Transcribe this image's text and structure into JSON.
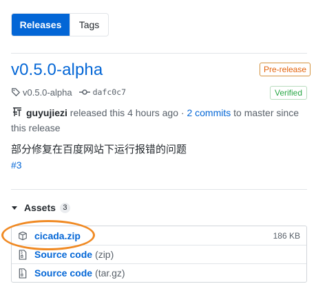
{
  "tabs": [
    {
      "label": "Releases",
      "active": true
    },
    {
      "label": "Tags",
      "active": false
    }
  ],
  "release": {
    "title": "v0.5.0-alpha",
    "prerelease_label": "Pre-release",
    "verified_label": "Verified",
    "tag": "v0.5.0-alpha",
    "commit_sha": "dafc0c7",
    "author": "guyujiezi",
    "released_text": " released this 4 hours ago · ",
    "commits_link": "2 commits",
    "to_master_text": " to master since this release",
    "description": "部分修复在百度网站下运行报错的问题",
    "issue_link": "#3"
  },
  "assets": {
    "label": "Assets",
    "count": "3",
    "items": [
      {
        "name": "cicada.zip",
        "size": "186 KB",
        "icon": "package-icon"
      },
      {
        "name": "Source code",
        "format": "(zip)",
        "icon": "file-zip-icon"
      },
      {
        "name": "Source code",
        "format": "(tar.gz)",
        "icon": "file-zip-icon"
      }
    ]
  },
  "colors": {
    "accent": "#0366d6",
    "prerelease": "#e36209",
    "verified": "#28a745",
    "highlight": "#f08a24"
  }
}
